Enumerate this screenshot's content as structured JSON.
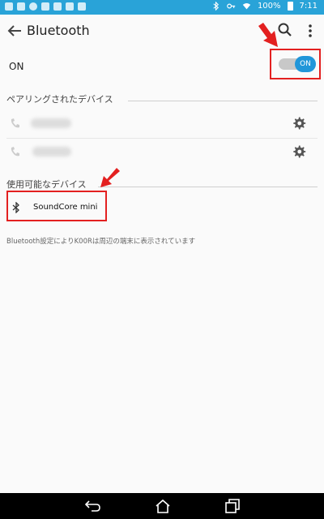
{
  "status_bar": {
    "battery": "100%",
    "time": "7:11",
    "icons": [
      "shield-icon",
      "mail-icon",
      "record-icon",
      "image-icon",
      "notification-icon",
      "screenshot-icon",
      "bag-icon",
      "bluetooth-icon",
      "key-icon",
      "wifi-icon",
      "battery-icon"
    ]
  },
  "app_bar": {
    "title": "Bluetooth",
    "icons": [
      "back-icon",
      "search-icon",
      "overflow-menu-icon"
    ]
  },
  "bluetooth_toggle": {
    "label": "ON",
    "switch_text": "ON",
    "state": true
  },
  "paired_section": {
    "title": "ペアリングされたデバイス",
    "devices": [
      {
        "icon": "phone-icon",
        "settings_icon": "gear-icon"
      },
      {
        "icon": "phone-icon",
        "settings_icon": "gear-icon"
      }
    ]
  },
  "available_section": {
    "title": "使用可能なデバイス",
    "devices": [
      {
        "name": "SoundCore mini",
        "icon": "bluetooth-icon"
      }
    ]
  },
  "visibility_note": "Bluetooth設定によりK00Rは周辺の端末に表示されています",
  "annotation_color": "#e32020",
  "accent_color": "#2196d9",
  "nav_bar": {
    "icons": [
      "back-nav-icon",
      "home-nav-icon",
      "recents-nav-icon"
    ]
  }
}
